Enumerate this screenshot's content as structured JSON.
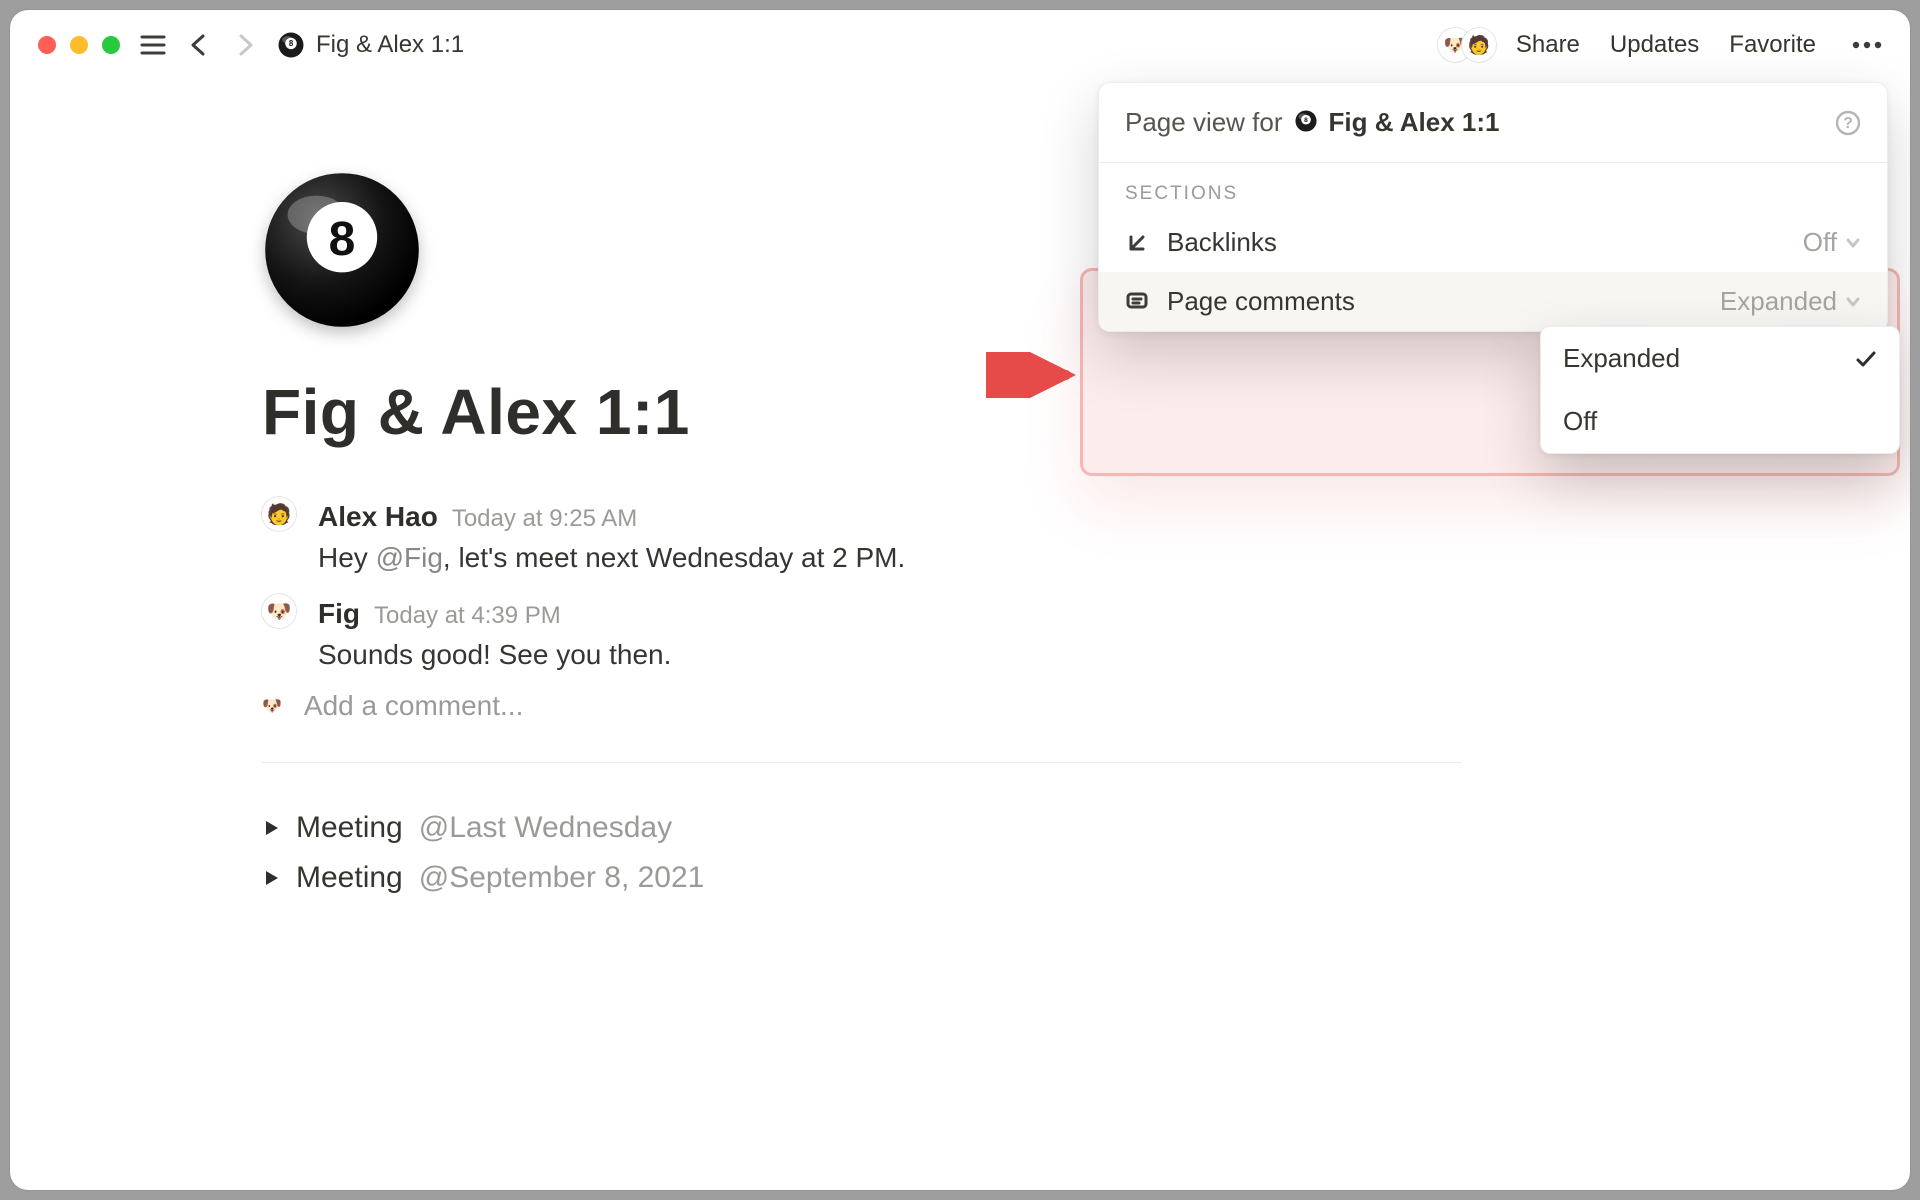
{
  "window": {
    "breadcrumb_title": "Fig & Alex 1:1"
  },
  "topbar": {
    "share": "Share",
    "updates": "Updates",
    "favorite": "Favorite"
  },
  "page": {
    "title": "Fig & Alex 1:1",
    "add_comment_placeholder": "Add a comment..."
  },
  "comments": [
    {
      "author": "Alex Hao",
      "time": "Today at 9:25 AM",
      "text_before": "Hey ",
      "mention": "@Fig",
      "text_after": ", let's meet next Wednesday at 2 PM."
    },
    {
      "author": "Fig",
      "time": "Today at 4:39 PM",
      "text_before": "Sounds good! See you then.",
      "mention": "",
      "text_after": ""
    }
  ],
  "content": {
    "items": [
      {
        "label": "Meeting",
        "date": "@Last Wednesday"
      },
      {
        "label": "Meeting",
        "date": "@September 8, 2021"
      }
    ]
  },
  "panel": {
    "header_label": "Page view for",
    "header_title": "Fig & Alex 1:1",
    "sections_label": "SECTIONS",
    "backlinks_label": "Backlinks",
    "backlinks_value": "Off",
    "page_comments_label": "Page comments",
    "page_comments_value": "Expanded"
  },
  "dropdown": {
    "options": [
      "Expanded",
      "Off"
    ],
    "selected": "Expanded"
  }
}
